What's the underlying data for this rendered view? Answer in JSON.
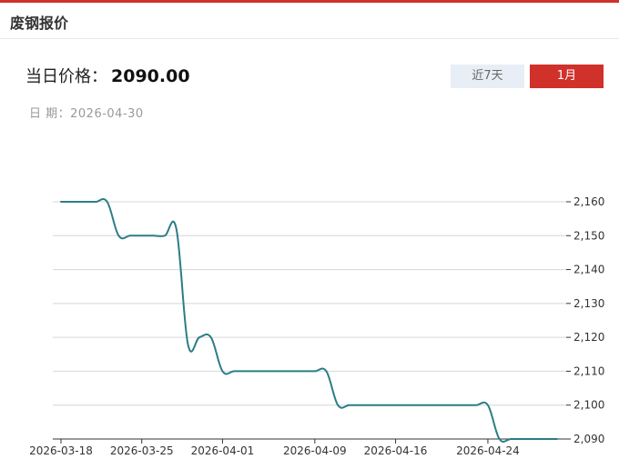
{
  "header": {
    "title": "废钢报价"
  },
  "price": {
    "label": "当日价格：",
    "value": "2090.00"
  },
  "date": {
    "label": "日 期：",
    "value": "2026-04-30"
  },
  "tabs": [
    {
      "label": "近7天",
      "active": false
    },
    {
      "label": "1月",
      "active": true
    }
  ],
  "colors": {
    "accent": "#d0312b",
    "line": "#2b7d86",
    "tab_inactive_bg": "#e8eef6"
  },
  "chart_data": {
    "type": "line",
    "title": "",
    "xlabel": "",
    "ylabel": "",
    "ylim": [
      2090,
      2160
    ],
    "y_ticks": [
      2160,
      2150,
      2140,
      2130,
      2120,
      2110,
      2100,
      2090
    ],
    "y_tick_labels": [
      "2,160",
      "2,150",
      "2,140",
      "2,130",
      "2,120",
      "2,110",
      "2,100",
      "2,090"
    ],
    "x_tick_labels": [
      "2026-03-18",
      "2026-03-25",
      "2026-04-01",
      "2026-04-09",
      "2026-04-16",
      "2026-04-24"
    ],
    "grid": true,
    "y_axis_position": "right",
    "series": [
      {
        "x": [
          "2026-03-18",
          "2026-03-19",
          "2026-03-20",
          "2026-03-21",
          "2026-03-22",
          "2026-03-23",
          "2026-03-24",
          "2026-03-25",
          "2026-03-26",
          "2026-03-27",
          "2026-03-28",
          "2026-03-29",
          "2026-03-30",
          "2026-03-31",
          "2026-04-01",
          "2026-04-02",
          "2026-04-03",
          "2026-04-04",
          "2026-04-05",
          "2026-04-06",
          "2026-04-07",
          "2026-04-08",
          "2026-04-09",
          "2026-04-10",
          "2026-04-11",
          "2026-04-12",
          "2026-04-13",
          "2026-04-14",
          "2026-04-15",
          "2026-04-16",
          "2026-04-17",
          "2026-04-18",
          "2026-04-19",
          "2026-04-20",
          "2026-04-21",
          "2026-04-22",
          "2026-04-23",
          "2026-04-24",
          "2026-04-25",
          "2026-04-26",
          "2026-04-27",
          "2026-04-28",
          "2026-04-29",
          "2026-04-30"
        ],
        "values": [
          2160,
          2160,
          2160,
          2160,
          2160,
          2150,
          2150,
          2150,
          2150,
          2150,
          2152,
          2118,
          2120,
          2120,
          2110,
          2110,
          2110,
          2110,
          2110,
          2110,
          2110,
          2110,
          2110,
          2110,
          2100,
          2100,
          2100,
          2100,
          2100,
          2100,
          2100,
          2100,
          2100,
          2100,
          2100,
          2100,
          2100,
          2100,
          2090,
          2090,
          2090,
          2090,
          2090,
          2090
        ]
      }
    ]
  }
}
